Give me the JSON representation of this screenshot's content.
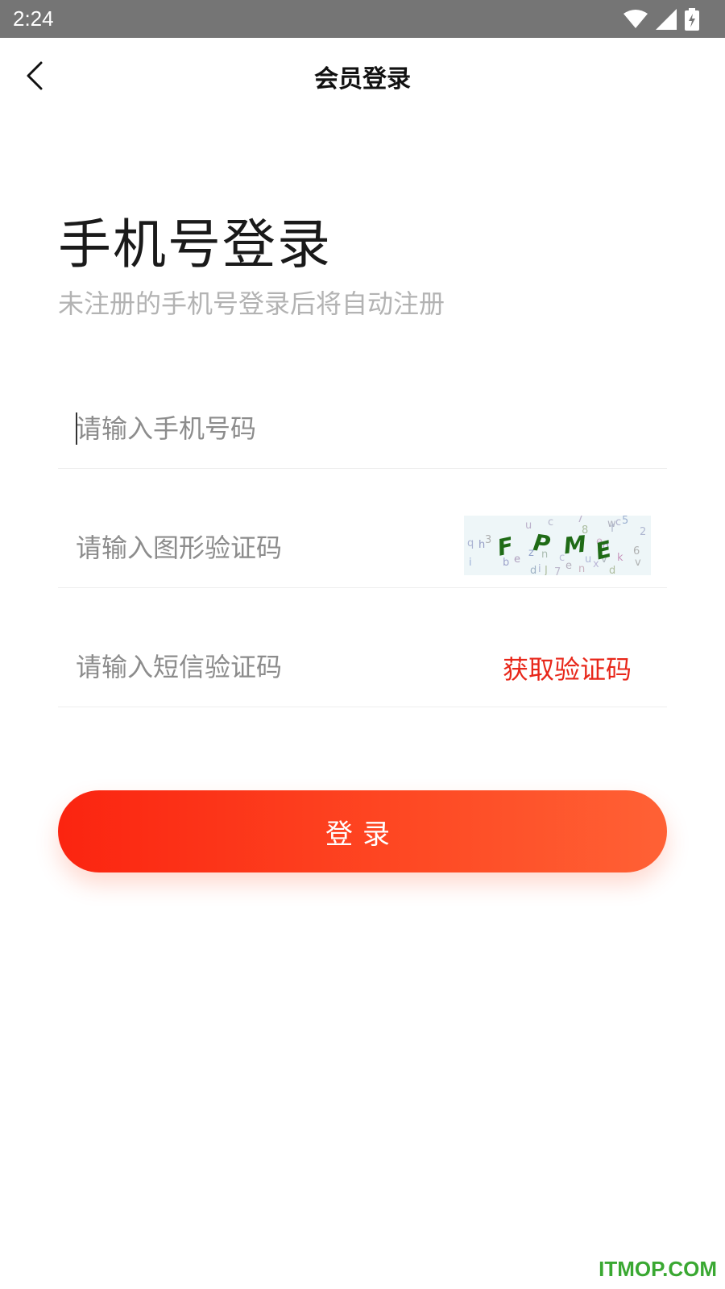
{
  "status_bar": {
    "time": "2:24",
    "icons": [
      "wifi-icon",
      "signal-icon",
      "battery-charging-icon"
    ]
  },
  "nav": {
    "title": "会员登录",
    "back_icon": "chevron-left-icon"
  },
  "page": {
    "heading": "手机号登录",
    "subheading": "未注册的手机号登录后将自动注册"
  },
  "form": {
    "phone_placeholder": "请输入手机号码",
    "captcha_placeholder": "请输入图形验证码",
    "captcha_text": "FPME",
    "sms_placeholder": "请输入短信验证码",
    "sms_button": "获取验证码",
    "login_button": "登录"
  },
  "colors": {
    "accent": "#e8271a",
    "button_start": "#fb2410",
    "button_end": "#ff6135"
  },
  "watermark": "ITMOP.COM"
}
